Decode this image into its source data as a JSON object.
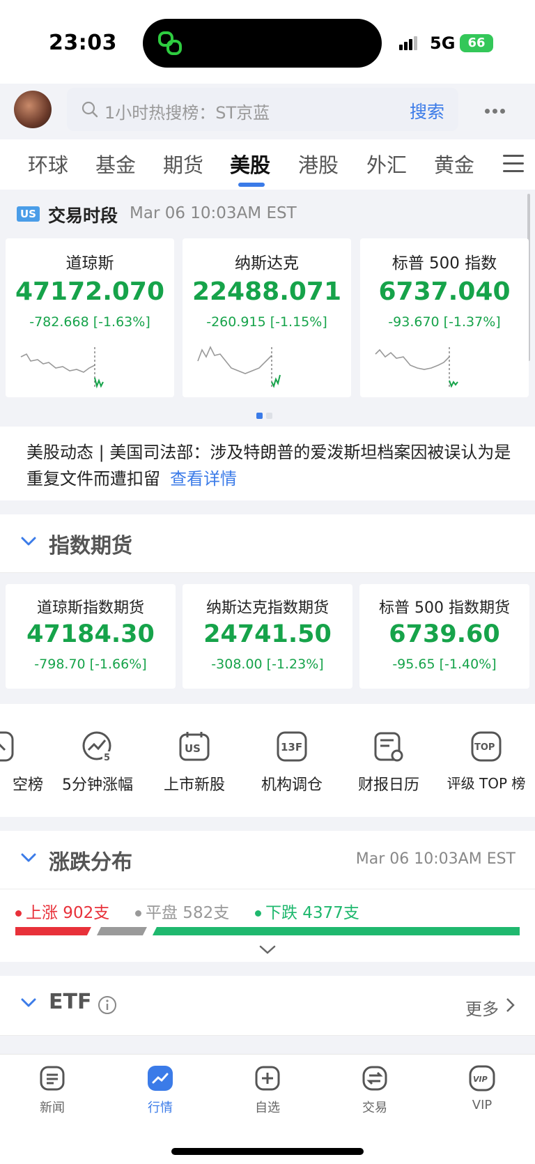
{
  "status": {
    "time": "23:03",
    "network": "5G",
    "battery": "66"
  },
  "search": {
    "placeholder": "1小时热搜榜：ST京蓝",
    "button": "搜索"
  },
  "tabs": [
    "环球",
    "基金",
    "期货",
    "美股",
    "港股",
    "外汇",
    "黄金"
  ],
  "active_tab": "美股",
  "session": {
    "badge": "US",
    "title": "交易时段",
    "time": "Mar 06 10:03AM EST",
    "cards": [
      {
        "name": "道琼斯",
        "value": "47172.070",
        "change": "-782.668 [-1.63%]"
      },
      {
        "name": "纳斯达克",
        "value": "22488.071",
        "change": "-260.915 [-1.15%]"
      },
      {
        "name": "标普 500 指数",
        "value": "6737.040",
        "change": "-93.670 [-1.37%]"
      }
    ]
  },
  "news": {
    "text": "美股动态 | 美国司法部：涉及特朗普的爱泼斯坦档案因被误认为是重复文件而遭扣留",
    "link": "查看详情"
  },
  "futures": {
    "title": "指数期货",
    "cards": [
      {
        "name": "道琼斯指数期货",
        "value": "47184.30",
        "change": "-798.70 [-1.66%]"
      },
      {
        "name": "纳斯达克指数期货",
        "value": "24741.50",
        "change": "-308.00 [-1.23%]"
      },
      {
        "name": "标普 500 指数期货",
        "value": "6739.60",
        "change": "-95.65 [-1.40%]"
      }
    ]
  },
  "tools": [
    {
      "label": "空榜",
      "icon": "chart-icon"
    },
    {
      "label": "5分钟涨幅",
      "icon": "trend-5min-icon"
    },
    {
      "label": "上市新股",
      "icon": "us-calendar-icon"
    },
    {
      "label": "机构调仓",
      "icon": "13f-icon"
    },
    {
      "label": "财报日历",
      "icon": "report-calendar-icon"
    },
    {
      "label": "评级 TOP 榜",
      "icon": "top-icon"
    }
  ],
  "breadth": {
    "title": "涨跌分布",
    "time": "Mar 06 10:03AM EST",
    "up_label": "上涨 902支",
    "flat_label": "平盘 582支",
    "down_label": "下跌 4377支",
    "up": 902,
    "flat": 582,
    "down": 4377,
    "colors": {
      "up": "#e8313a",
      "flat": "#9a9a9a",
      "down": "#1fb86e"
    }
  },
  "etf": {
    "title": "ETF",
    "more": "更多"
  },
  "tabbar": [
    {
      "label": "新闻",
      "icon": "news-icon"
    },
    {
      "label": "行情",
      "icon": "market-icon"
    },
    {
      "label": "自选",
      "icon": "watchlist-icon"
    },
    {
      "label": "交易",
      "icon": "trade-icon"
    },
    {
      "label": "VIP",
      "icon": "vip-icon"
    }
  ],
  "accent": "#3b7be8",
  "down_color": "#16a34a"
}
